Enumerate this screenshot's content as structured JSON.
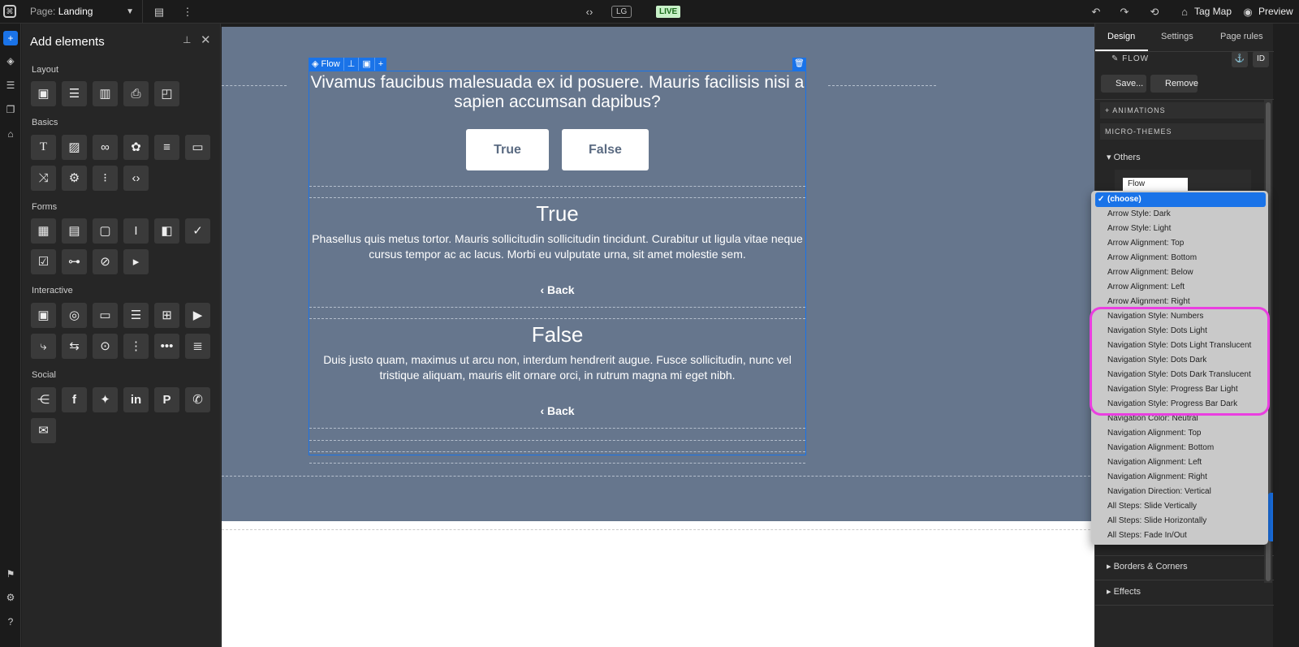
{
  "topbar": {
    "page_label": "Page:",
    "page_value": "Landing",
    "breakpoint": "LG",
    "live": "LIVE",
    "tagmap": "Tag Map",
    "preview": "Preview"
  },
  "addpanel": {
    "title": "Add elements",
    "sections": {
      "layout": "Layout",
      "basics": "Basics",
      "forms": "Forms",
      "interactive": "Interactive",
      "social": "Social"
    }
  },
  "canvas": {
    "flow_tag": "Flow",
    "question": "Vivamus faucibus malesuada ex id posuere. Mauris facilisis nisi a sapien accumsan dapibus?",
    "true_btn": "True",
    "false_btn": "False",
    "true_title": "True",
    "true_body": "Phasellus quis metus tortor. Mauris sollicitudin sollicitudin tincidunt. Curabitur ut ligula vitae neque cursus tempor ac ac lacus. Morbi eu vulputate urna, sit amet molestie sem.",
    "false_title": "False",
    "false_body": "Duis justo quam, maximus ut arcu non, interdum hendrerit augue. Fusce sollicitudin, nunc vel tristique aliquam, mauris elit ornare orci, in rutrum magna mi eget nibh.",
    "back": "Back"
  },
  "rightpanel": {
    "tabs": [
      "Design",
      "Settings",
      "Page rules"
    ],
    "element": "FLOW",
    "id_btn": "ID",
    "save": "Save...",
    "remove": "Remove",
    "animations": "+ ANIMATIONS",
    "microthemes": "MICRO-THEMES",
    "others": "Others",
    "select_value": "Flow",
    "borders": "Borders & Corners",
    "effects": "Effects"
  },
  "dropdown": {
    "selected": "(choose)",
    "options": [
      "Arrow Style: Dark",
      "Arrow Style: Light",
      "Arrow Alignment: Top",
      "Arrow Alignment: Bottom",
      "Arrow Alignment: Below",
      "Arrow Alignment: Left",
      "Arrow Alignment: Right",
      "Navigation Style: Numbers",
      "Navigation Style: Dots Light",
      "Navigation Style: Dots Light Translucent",
      "Navigation Style: Dots Dark",
      "Navigation Style: Dots Dark Translucent",
      "Navigation Style: Progress Bar Light",
      "Navigation Style: Progress Bar Dark",
      "Navigation Color: Neutral",
      "Navigation Alignment: Top",
      "Navigation Alignment: Bottom",
      "Navigation Alignment: Left",
      "Navigation Alignment: Right",
      "Navigation Direction: Vertical",
      "All Steps: Slide Vertically",
      "All Steps: Slide Horizontally",
      "All Steps: Fade In/Out"
    ]
  },
  "colors": {
    "accent": "#1a73e8",
    "canvas": "#66768d",
    "highlight": "#ea3ee0"
  }
}
